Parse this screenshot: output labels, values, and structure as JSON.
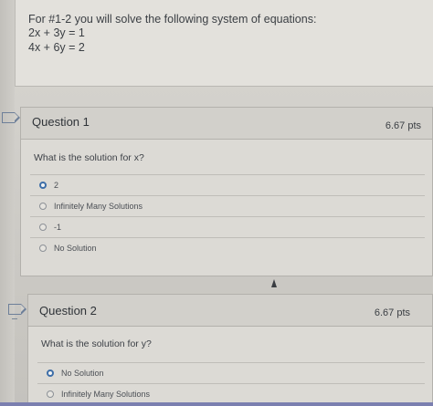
{
  "intro": {
    "line1": "For #1-2 you will solve the following system of equations:",
    "line2": "2x + 3y = 1",
    "line3": "4x + 6y = 2"
  },
  "questions": [
    {
      "title": "Question 1",
      "points": "6.67 pts",
      "text": "What is the solution for x?",
      "answers": [
        {
          "label": "2",
          "selected": true
        },
        {
          "label": "Infinitely Many Solutions",
          "selected": false
        },
        {
          "label": "-1",
          "selected": false
        },
        {
          "label": "No Solution",
          "selected": false
        }
      ]
    },
    {
      "title": "Question 2",
      "points": "6.67 pts",
      "text": "What is the solution for y?",
      "answers": [
        {
          "label": "No Solution",
          "selected": true
        },
        {
          "label": "Infinitely Many Solutions",
          "selected": false
        }
      ]
    }
  ],
  "colors": {
    "accent": "#3d6ea8",
    "bottom_bar": "#7b7fb0"
  }
}
